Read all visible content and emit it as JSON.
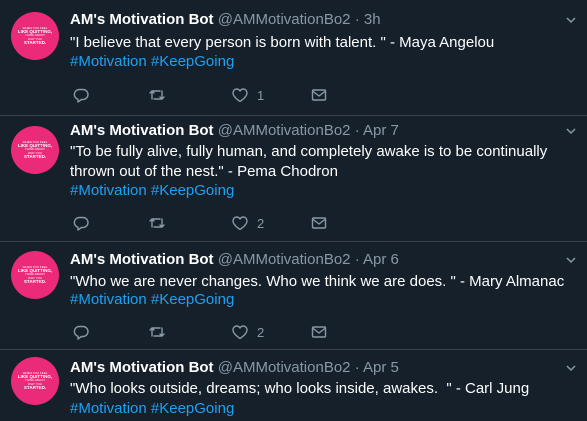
{
  "tweets": [
    {
      "name": "AM's Motivation Bot",
      "handle": "@AMMotivationBo2",
      "separator": "·",
      "time": "3h",
      "text": "\"I believe that every person is born with talent. \" - Maya Angelou",
      "hashtags": [
        "#Motivation",
        "#KeepGoing"
      ],
      "like_count": "1"
    },
    {
      "name": "AM's Motivation Bot",
      "handle": "@AMMotivationBo2",
      "separator": "·",
      "time": "Apr 7",
      "text": "\"To be fully alive, fully human, and completely awake is to be continually thrown out of the nest.\" - Pema Chodron",
      "hashtags": [
        "#Motivation",
        "#KeepGoing"
      ],
      "like_count": "2"
    },
    {
      "name": "AM's Motivation Bot",
      "handle": "@AMMotivationBo2",
      "separator": "·",
      "time": "Apr 6",
      "text": "\"Who we are never changes. Who we think we are does. \" - Mary Almanac",
      "hashtags": [
        "#Motivation",
        "#KeepGoing"
      ],
      "like_count": "2"
    },
    {
      "name": "AM's Motivation Bot",
      "handle": "@AMMotivationBo2",
      "separator": "·",
      "time": "Apr 5",
      "text": "\"Who looks outside, dreams; who looks inside, awakes.  \" - Carl Jung",
      "hashtags": [
        "#Motivation",
        "#KeepGoing"
      ],
      "like_count": ""
    }
  ],
  "avatar_text": [
    "WHEN YOU FEEL",
    "LIKE QUITTING,",
    "THINK ABOUT",
    "WHY YOU",
    "STARTED."
  ],
  "icons": {
    "reply": "reply-icon",
    "retweet": "retweet-icon",
    "like": "like-icon",
    "dm": "direct-message-icon",
    "more": "chevron-down-icon"
  },
  "colors": {
    "background": "#15202b",
    "divider": "#38444d",
    "accent": "#1da1f2",
    "secondary_text": "#8899a6",
    "avatar_bg": "#ec2a7a"
  }
}
